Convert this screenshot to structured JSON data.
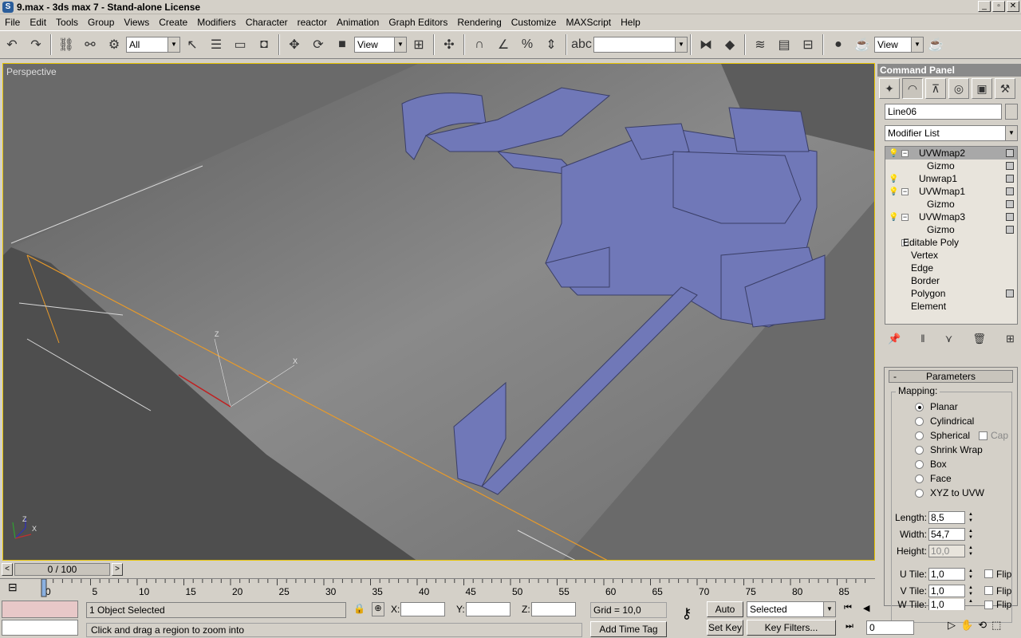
{
  "window": {
    "title": "9.max - 3ds max 7  - Stand-alone License",
    "min": "_",
    "max": "▫",
    "close": "✕"
  },
  "menu": [
    "File",
    "Edit",
    "Tools",
    "Group",
    "Views",
    "Create",
    "Modifiers",
    "Character",
    "reactor",
    "Animation",
    "Graph Editors",
    "Rendering",
    "Customize",
    "MAXScript",
    "Help"
  ],
  "toolbar": {
    "selection_filter": "All",
    "ref_coord": "View",
    "named_selection": "",
    "render_view": "View"
  },
  "viewport": {
    "label": "Perspective",
    "axes": {
      "x": "X",
      "y": "Y",
      "z": "Z"
    }
  },
  "command_panel": {
    "title": "Command Panel",
    "object_name": "Line06",
    "modifier_list": "Modifier List",
    "stack": [
      {
        "label": "UVWmap2",
        "level": 0,
        "bulb": true,
        "expand": "−",
        "selected": true,
        "box": true
      },
      {
        "label": "Gizmo",
        "level": 1,
        "bulb": false,
        "expand": "",
        "selected": false,
        "box": true
      },
      {
        "label": "Unwrap1",
        "level": 0,
        "bulb": true,
        "expand": "",
        "selected": false,
        "box": true
      },
      {
        "label": "UVWmap1",
        "level": 0,
        "bulb": true,
        "expand": "−",
        "selected": false,
        "box": true
      },
      {
        "label": "Gizmo",
        "level": 1,
        "bulb": false,
        "expand": "",
        "selected": false,
        "box": true
      },
      {
        "label": "UVWmap3",
        "level": 0,
        "bulb": true,
        "expand": "−",
        "selected": false,
        "box": true
      },
      {
        "label": "Gizmo",
        "level": 1,
        "bulb": false,
        "expand": "",
        "selected": false,
        "box": true
      },
      {
        "label": "Editable Poly",
        "level": 0,
        "bulb": false,
        "expand": "−",
        "selected": false,
        "box": false
      },
      {
        "label": "Vertex",
        "level": 1,
        "bulb": false,
        "expand": "",
        "selected": false,
        "box": false
      },
      {
        "label": "Edge",
        "level": 1,
        "bulb": false,
        "expand": "",
        "selected": false,
        "box": false
      },
      {
        "label": "Border",
        "level": 1,
        "bulb": false,
        "expand": "",
        "selected": false,
        "box": false
      },
      {
        "label": "Polygon",
        "level": 1,
        "bulb": false,
        "expand": "",
        "selected": false,
        "box": true
      },
      {
        "label": "Element",
        "level": 1,
        "bulb": false,
        "expand": "",
        "selected": false,
        "box": false
      }
    ],
    "parameters": {
      "title": "Parameters",
      "collapse": "-",
      "mapping_label": "Mapping:",
      "mapping_options": [
        "Planar",
        "Cylindrical",
        "Spherical",
        "Shrink Wrap",
        "Box",
        "Face",
        "XYZ to UVW"
      ],
      "mapping_selected": "Planar",
      "cap_label": "Cap",
      "length_label": "Length:",
      "length": "8,5",
      "width_label": "Width:",
      "width": "54,7",
      "height_label": "Height:",
      "height": "10,0",
      "utile_label": "U Tile:",
      "utile": "1,0",
      "vtile_label": "V Tile:",
      "vtile": "1,0",
      "wtile_label": "W Tile:",
      "wtile": "1,0",
      "flip_label": "Flip"
    }
  },
  "time": {
    "slider": "0 / 100",
    "ticks": [
      "0",
      "5",
      "10",
      "15",
      "20",
      "25",
      "30",
      "35",
      "40",
      "45",
      "50",
      "55",
      "60",
      "65",
      "70",
      "75",
      "80",
      "85"
    ]
  },
  "status": {
    "selected": "1 Object Selected",
    "prompt": "Click and drag a region to zoom into",
    "x_label": "X:",
    "y_label": "Y:",
    "z_label": "Z:",
    "x": "",
    "y": "",
    "z": "",
    "grid": "Grid = 10,0",
    "add_time_tag": "Add Time Tag",
    "auto_key": "Auto Key",
    "set_key": "Set Key",
    "key_mode": "Selected",
    "key_filters": "Key Filters...",
    "frame": "0"
  }
}
